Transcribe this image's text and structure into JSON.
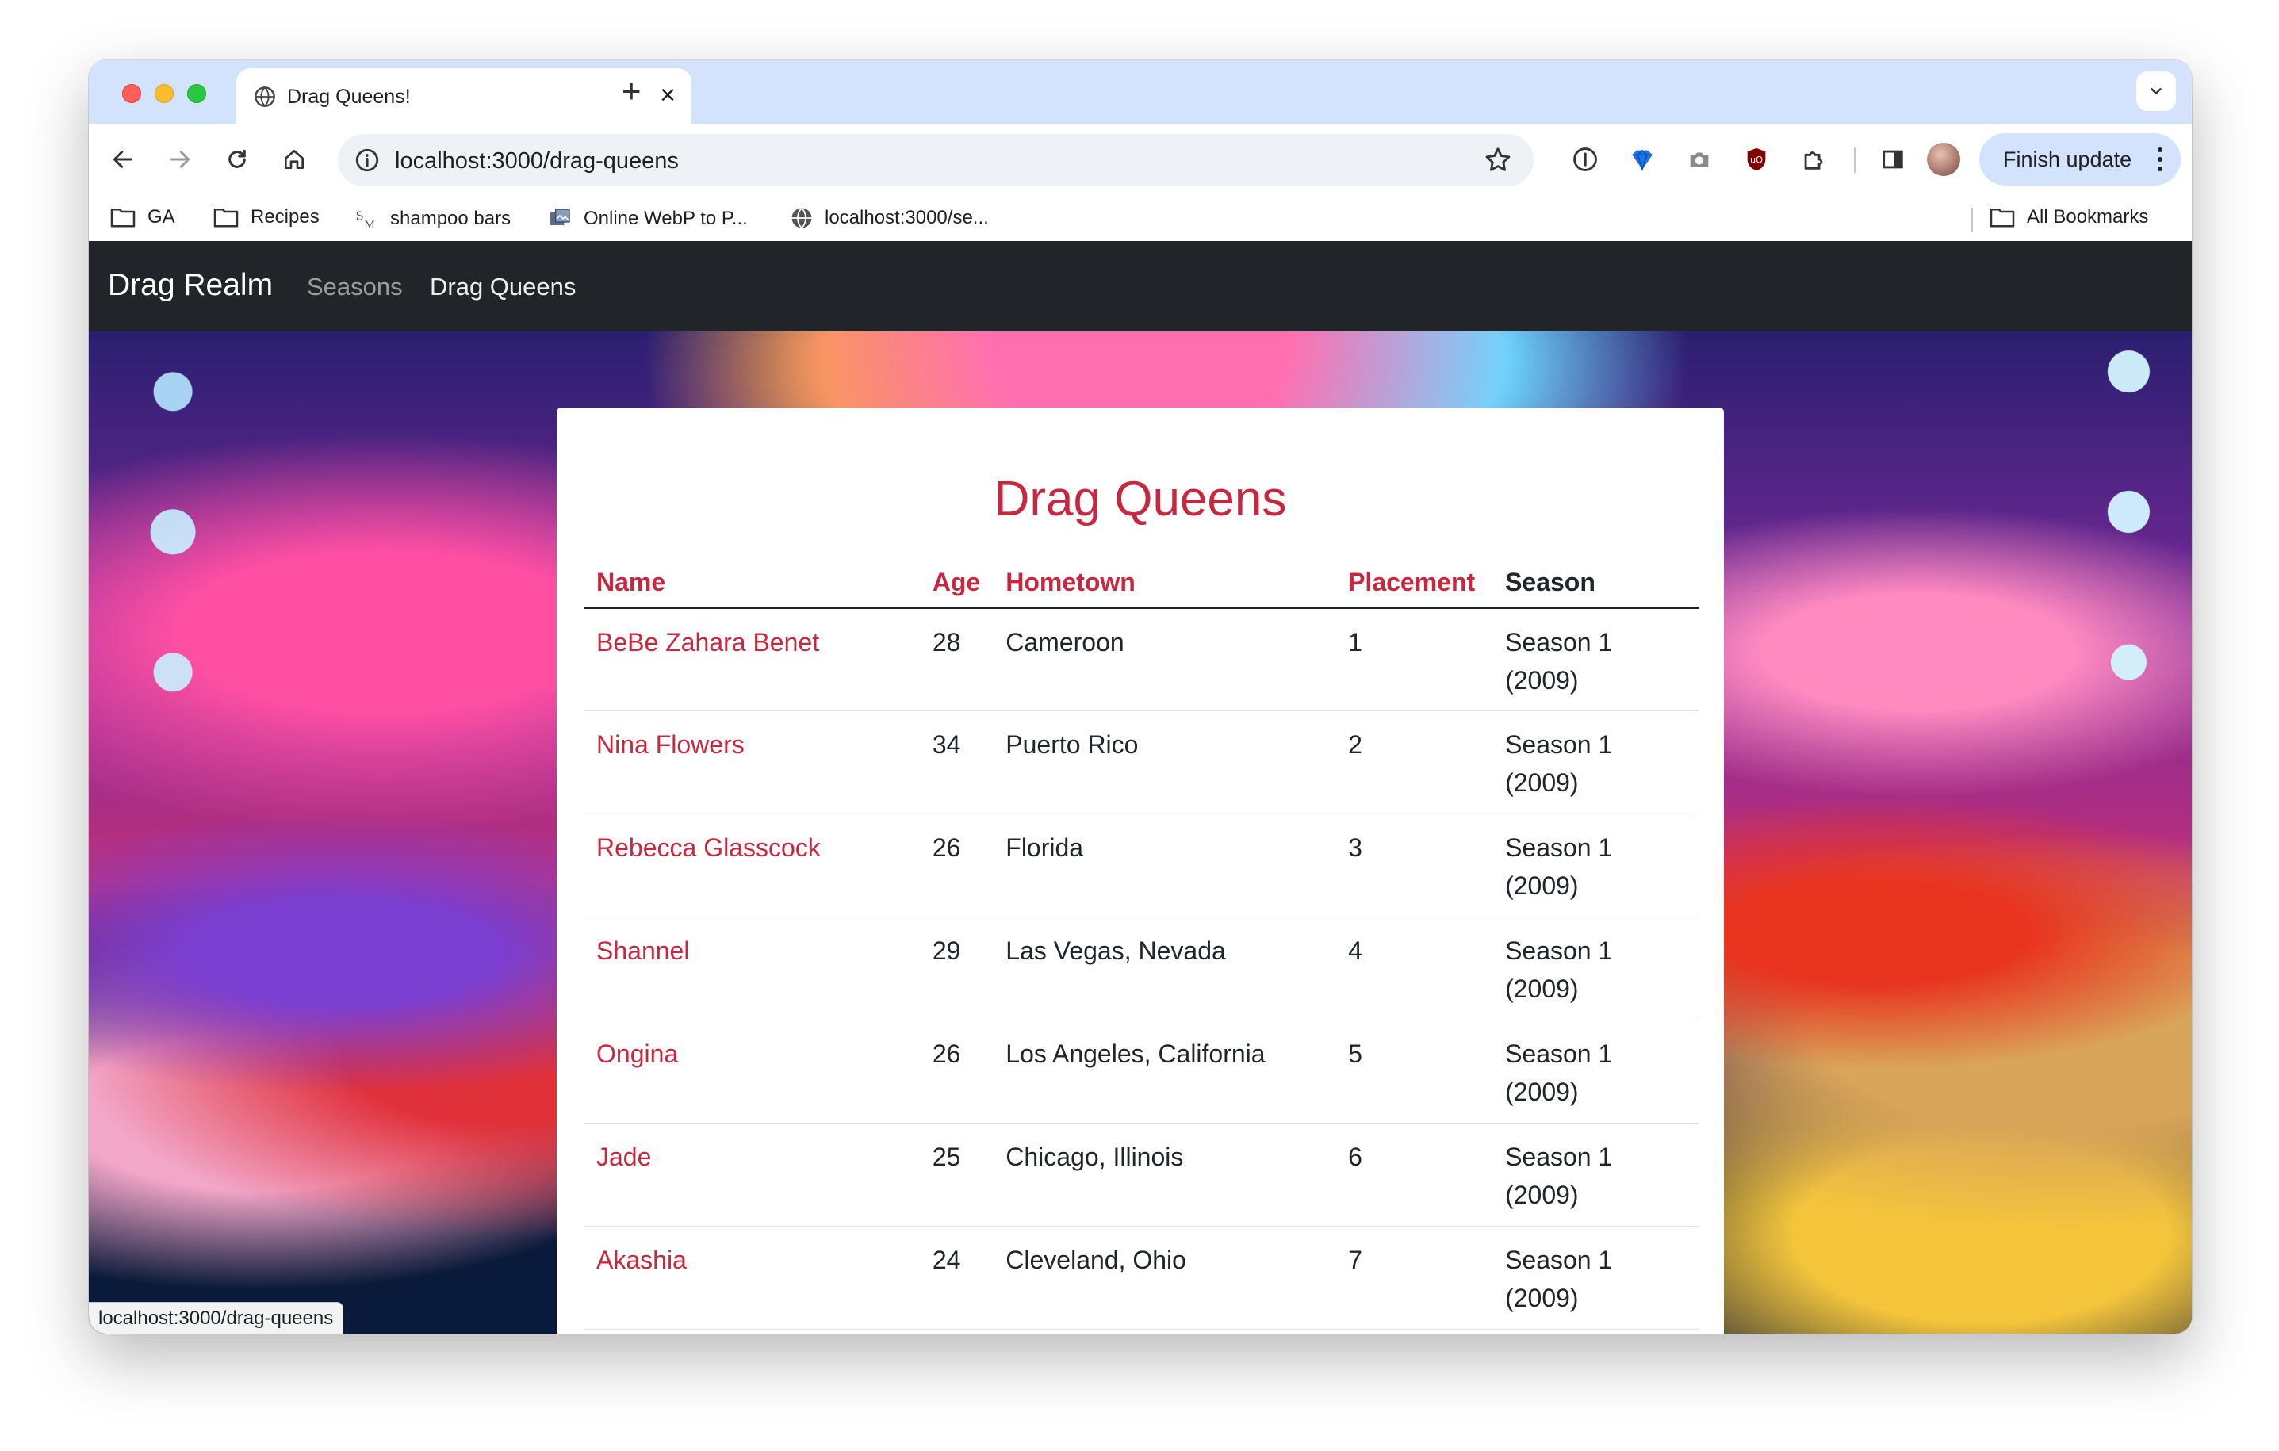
{
  "browser": {
    "tab_title": "Drag Queens!",
    "new_tab": "+",
    "close_tab": "×",
    "url": "localhost:3000/drag-queens",
    "update_button": "Finish update",
    "status_url": "localhost:3000/drag-queens"
  },
  "bookmarks": {
    "items": [
      {
        "label": "GA",
        "icon": "folder-icon"
      },
      {
        "label": "Recipes",
        "icon": "folder-icon"
      },
      {
        "label": "shampoo bars",
        "icon": "site-icon"
      },
      {
        "label": "Online WebP to P...",
        "icon": "site-icon"
      },
      {
        "label": "localhost:3000/se...",
        "icon": "globe-icon"
      }
    ],
    "all_bookmarks": "All Bookmarks"
  },
  "site": {
    "brand": "Drag Realm",
    "nav": [
      {
        "label": "Seasons",
        "active": false
      },
      {
        "label": "Drag Queens",
        "active": true
      }
    ]
  },
  "main": {
    "title": "Drag Queens",
    "columns": [
      "Name",
      "Age",
      "Hometown",
      "Placement",
      "Season"
    ],
    "rows": [
      {
        "name": "BeBe Zahara Benet",
        "age": "28",
        "hometown": "Cameroon",
        "placement": "1",
        "season": "Season 1 (2009)"
      },
      {
        "name": "Nina Flowers",
        "age": "34",
        "hometown": "Puerto Rico",
        "placement": "2",
        "season": "Season 1 (2009)"
      },
      {
        "name": "Rebecca Glasscock",
        "age": "26",
        "hometown": "Florida",
        "placement": "3",
        "season": "Season 1 (2009)"
      },
      {
        "name": "Shannel",
        "age": "29",
        "hometown": "Las Vegas, Nevada",
        "placement": "4",
        "season": "Season 1 (2009)"
      },
      {
        "name": "Ongina",
        "age": "26",
        "hometown": "Los Angeles, California",
        "placement": "5",
        "season": "Season 1 (2009)"
      },
      {
        "name": "Jade",
        "age": "25",
        "hometown": "Chicago, Illinois",
        "placement": "6",
        "season": "Season 1 (2009)"
      },
      {
        "name": "Akashia",
        "age": "24",
        "hometown": "Cleveland, Ohio",
        "placement": "7",
        "season": "Season 1 (2009)"
      }
    ]
  },
  "colors": {
    "accent": "#c8283f",
    "navbar": "#212529",
    "tabstrip": "#d3e3fd"
  }
}
